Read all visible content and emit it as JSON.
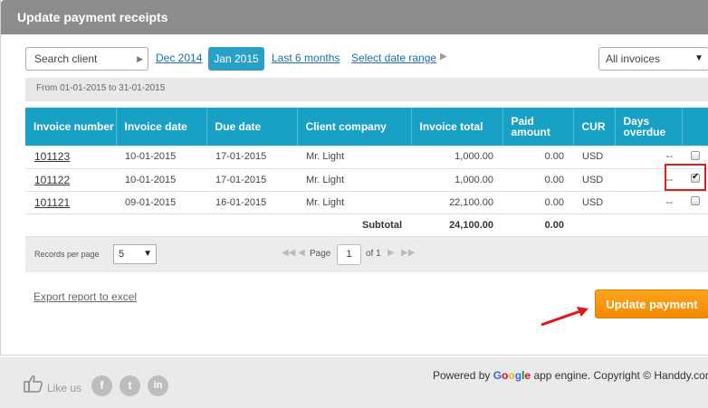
{
  "title": "Update payment receipts",
  "toolbar": {
    "search_client": "Search client",
    "periods": [
      "Dec 2014",
      "Jan 2015",
      "Last 6 months",
      "Select date range"
    ],
    "active_period": "Jan 2015",
    "invoice_filter": "All invoices"
  },
  "date_range": "From 01-01-2015 to 31-01-2015",
  "table": {
    "headers": [
      "Invoice number",
      "Invoice date",
      "Due date",
      "Client company",
      "Invoice total",
      "Paid amount",
      "CUR",
      "Days overdue"
    ],
    "rows": [
      {
        "invoice": "101123",
        "invoice_date": "10-01-2015",
        "due_date": "17-01-2015",
        "client": "Mr. Light",
        "total": "1,000.00",
        "paid": "0.00",
        "cur": "USD",
        "overdue": "--",
        "checked": false
      },
      {
        "invoice": "101122",
        "invoice_date": "10-01-2015",
        "due_date": "17-01-2015",
        "client": "Mr. Light",
        "total": "1,000.00",
        "paid": "0.00",
        "cur": "USD",
        "overdue": "--",
        "checked": true
      },
      {
        "invoice": "101121",
        "invoice_date": "09-01-2015",
        "due_date": "16-01-2015",
        "client": "Mr. Light",
        "total": "22,100.00",
        "paid": "0.00",
        "cur": "USD",
        "overdue": "--",
        "checked": false
      }
    ],
    "subtotal_label": "Subtotal",
    "subtotal_total": "24,100.00",
    "subtotal_paid": "0.00"
  },
  "pager": {
    "records_label": "Records per page",
    "records_value": "5",
    "page_label": "Page",
    "page_value": "1",
    "of_label": "of 1"
  },
  "export_label": "Export report to excel",
  "update_button": "Update payment",
  "footer": {
    "like_label": "Like us",
    "social": [
      "f",
      "t",
      "in"
    ],
    "powered_prefix": "Powered by ",
    "google": [
      "G",
      "o",
      "o",
      "g",
      "l",
      "e"
    ],
    "powered_suffix": " app engine. Copyright © Handdy.com"
  },
  "colors": {
    "accent": "#19a0c5",
    "button": "#f28a00",
    "highlight": "#d9201f"
  }
}
